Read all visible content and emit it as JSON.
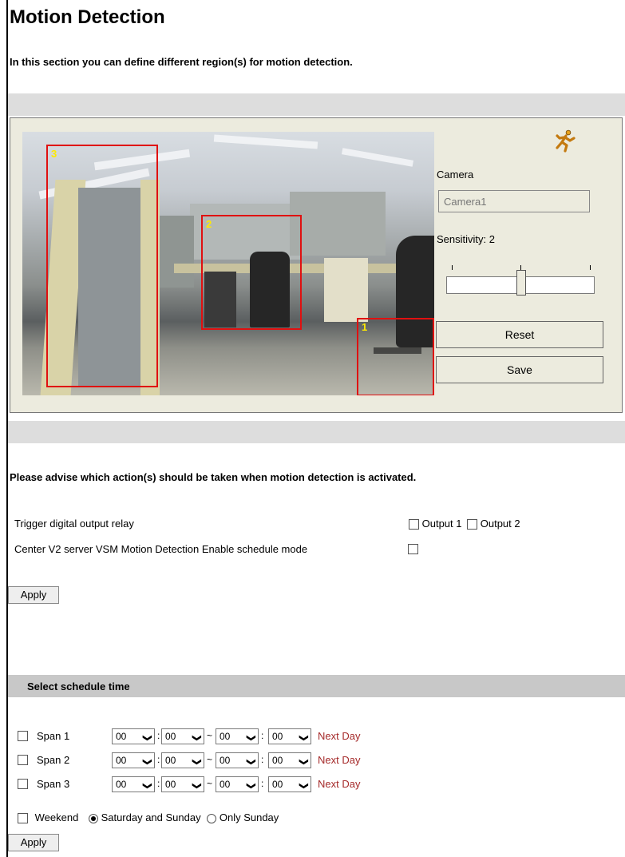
{
  "page": {
    "title": "Motion Detection",
    "intro": "In this section you can define different region(s) for motion detection."
  },
  "detection": {
    "regions": [
      "3",
      "2",
      "1"
    ],
    "camera_label": "Camera",
    "camera_placeholder": "Camera1",
    "sensitivity_label": "Sensitivity: 2",
    "sensitivity_level": 2,
    "reset_label": "Reset",
    "save_label": "Save",
    "icon": "running-man-icon"
  },
  "actions": {
    "heading": "Please advise which action(s) should be taken when motion detection is activated.",
    "relay_label": "Trigger digital output relay",
    "output1_label": "Output 1",
    "output2_label": "Output 2",
    "vsm_label": "Center V2 server VSM Motion Detection Enable schedule mode",
    "apply_label": "Apply"
  },
  "schedule": {
    "header": "Select schedule time",
    "next_day_label": "Next Day",
    "spans": [
      {
        "label": "Span 1",
        "start_h": "00",
        "start_m": "00",
        "end_h": "00",
        "end_m": "00"
      },
      {
        "label": "Span 2",
        "start_h": "00",
        "start_m": "00",
        "end_h": "00",
        "end_m": "00"
      },
      {
        "label": "Span 3",
        "start_h": "00",
        "start_m": "00",
        "end_h": "00",
        "end_m": "00"
      }
    ],
    "weekend_label": "Weekend",
    "weekend_options": [
      "Saturday and Sunday",
      "Only Sunday"
    ],
    "weekend_selected": "Saturday and Sunday",
    "apply_label": "Apply"
  }
}
